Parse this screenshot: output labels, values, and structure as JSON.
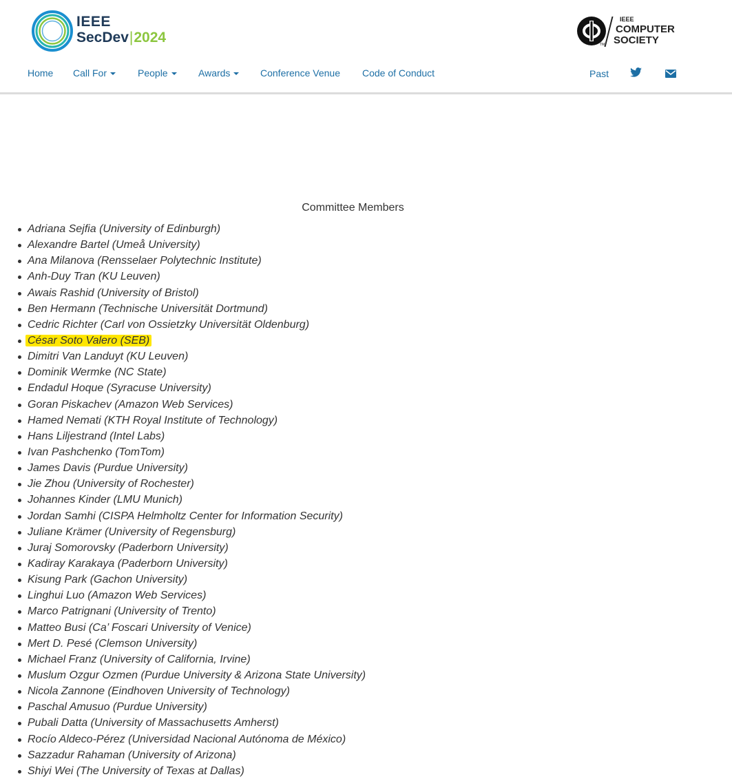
{
  "logo": {
    "line1": "IEEE",
    "line2_name": "SecDev",
    "line2_sep": "|",
    "line2_year": "2024",
    "colors": {
      "navy": "#1f3a58",
      "green": "#8cc63f",
      "ring_blue": "#1a8fd0",
      "ring_teal": "#27b5b0"
    }
  },
  "cs_logo": {
    "line1": "IEEE",
    "line2": "COMPUTER",
    "line3": "SOCIETY",
    "icon": "ieee-cs-phi-icon",
    "trademark": "TM"
  },
  "nav": {
    "items": [
      {
        "label": "Home",
        "dropdown": false
      },
      {
        "label": "Call For",
        "dropdown": true
      },
      {
        "label": "People",
        "dropdown": true
      },
      {
        "label": "Awards",
        "dropdown": true
      },
      {
        "label": "Conference Venue",
        "dropdown": false
      },
      {
        "label": "Code of Conduct",
        "dropdown": false
      }
    ],
    "past_label": "Past",
    "twitter_icon": "twitter-icon",
    "mail_icon": "mail-icon",
    "link_color": "#1d6fa5"
  },
  "section_title": "Committee Members",
  "highlight_color": "#ffe600",
  "members": [
    {
      "text": "Adriana Sejfia (University of Edinburgh)",
      "highlighted": false
    },
    {
      "text": "Alexandre Bartel (Umeå University)",
      "highlighted": false
    },
    {
      "text": "Ana Milanova (Rensselaer Polytechnic Institute)",
      "highlighted": false
    },
    {
      "text": "Anh-Duy Tran (KU Leuven)",
      "highlighted": false
    },
    {
      "text": "Awais Rashid (University of Bristol)",
      "highlighted": false
    },
    {
      "text": "Ben Hermann (Technische Universität Dortmund)",
      "highlighted": false
    },
    {
      "text": "Cedric Richter (Carl von Ossietzky Universität Oldenburg)",
      "highlighted": false
    },
    {
      "text": "César Soto Valero (SEB)",
      "highlighted": true
    },
    {
      "text": "Dimitri Van Landuyt (KU Leuven)",
      "highlighted": false
    },
    {
      "text": "Dominik Wermke (NC State)",
      "highlighted": false
    },
    {
      "text": "Endadul Hoque (Syracuse University)",
      "highlighted": false
    },
    {
      "text": "Goran Piskachev (Amazon Web Services)",
      "highlighted": false
    },
    {
      "text": "Hamed Nemati (KTH Royal Institute of Technology)",
      "highlighted": false
    },
    {
      "text": "Hans Liljestrand (Intel Labs)",
      "highlighted": false
    },
    {
      "text": "Ivan Pashchenko (TomTom)",
      "highlighted": false
    },
    {
      "text": "James Davis (Purdue University)",
      "highlighted": false
    },
    {
      "text": "Jie Zhou (University of Rochester)",
      "highlighted": false
    },
    {
      "text": "Johannes Kinder (LMU Munich)",
      "highlighted": false
    },
    {
      "text": "Jordan Samhi (CISPA Helmholtz Center for Information Security)",
      "highlighted": false
    },
    {
      "text": "Juliane Krämer (University of Regensburg)",
      "highlighted": false
    },
    {
      "text": "Juraj Somorovsky (Paderborn University)",
      "highlighted": false
    },
    {
      "text": "Kadiray Karakaya (Paderborn University)",
      "highlighted": false
    },
    {
      "text": "Kisung Park (Gachon University)",
      "highlighted": false
    },
    {
      "text": "Linghui Luo (Amazon Web Services)",
      "highlighted": false
    },
    {
      "text": "Marco Patrignani (University of Trento)",
      "highlighted": false
    },
    {
      "text": "Matteo Busi (Ca’ Foscari University of Venice)",
      "highlighted": false
    },
    {
      "text": "Mert D. Pesé (Clemson University)",
      "highlighted": false
    },
    {
      "text": "Michael Franz (University of California, Irvine)",
      "highlighted": false
    },
    {
      "text": "Muslum Ozgur Ozmen (Purdue University & Arizona State University)",
      "highlighted": false
    },
    {
      "text": "Nicola Zannone (Eindhoven University of Technology)",
      "highlighted": false
    },
    {
      "text": "Paschal Amusuo (Purdue University)",
      "highlighted": false
    },
    {
      "text": "Pubali Datta (University of Massachusetts Amherst)",
      "highlighted": false
    },
    {
      "text": "Rocío Aldeco-Pérez (Universidad Nacional Autónoma de México)",
      "highlighted": false
    },
    {
      "text": "Sazzadur Rahaman (University of Arizona)",
      "highlighted": false
    },
    {
      "text": "Shiyi Wei (The University of Texas at Dallas)",
      "highlighted": false
    }
  ]
}
